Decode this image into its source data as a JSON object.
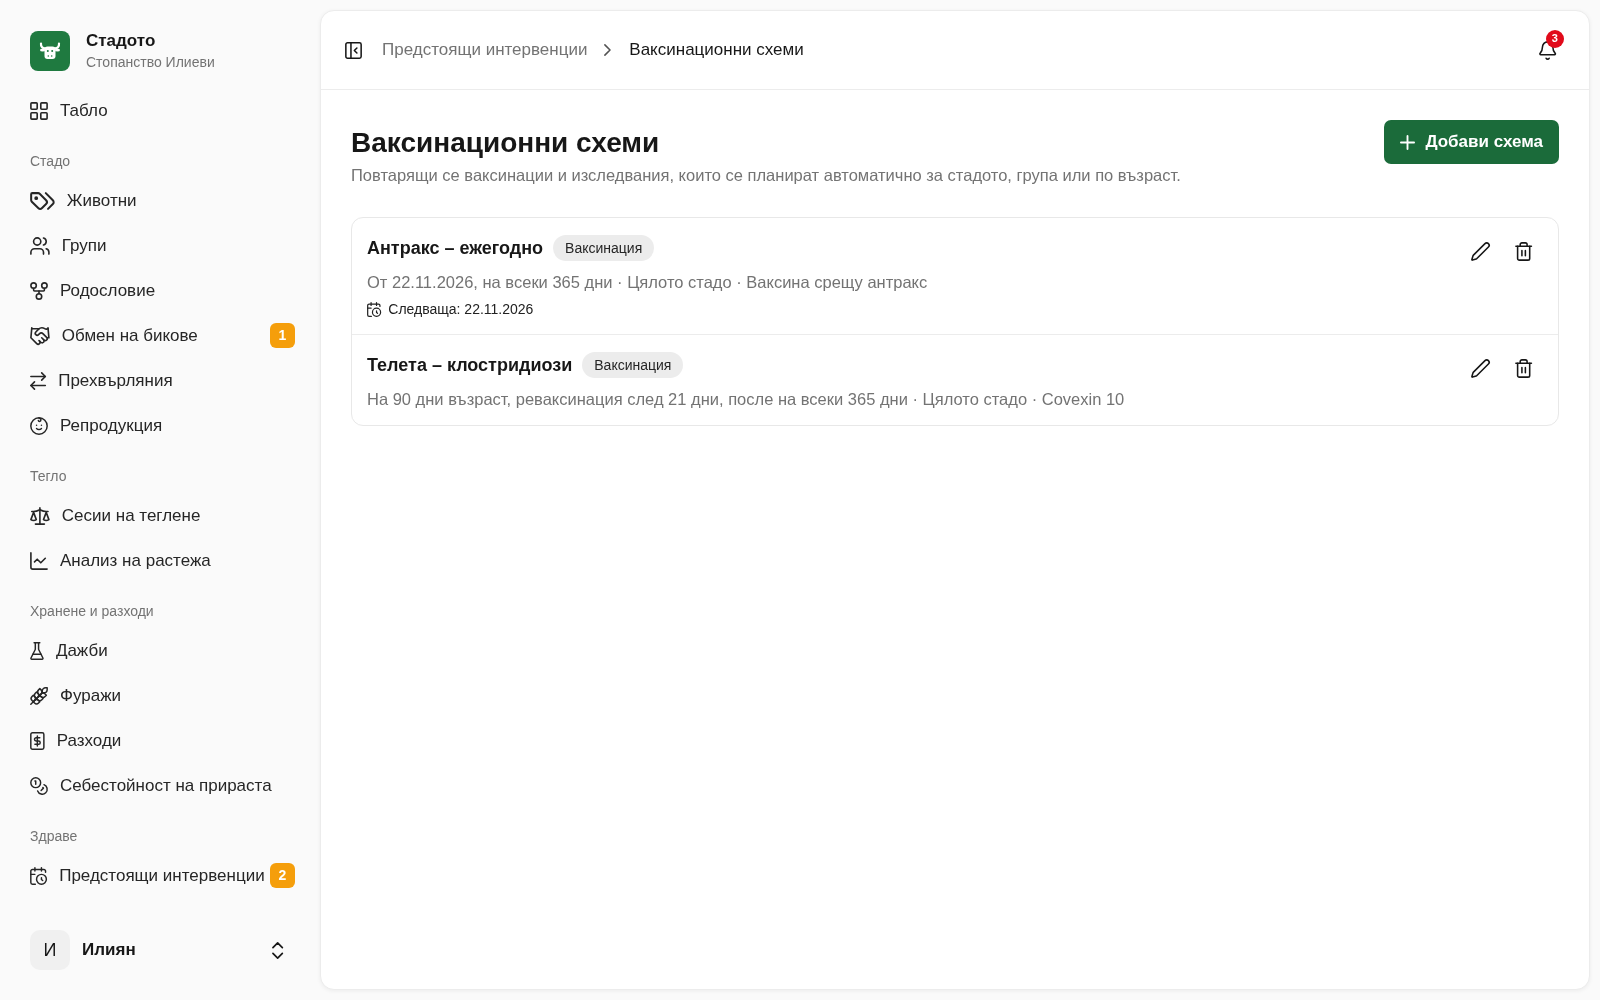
{
  "sidebar": {
    "brand": {
      "title": "Стадото",
      "subtitle": "Стопанство Илиеви"
    },
    "sections": [
      {
        "items": [
          {
            "label": "Табло",
            "selected": false
          }
        ]
      },
      {
        "heading": "Стадо",
        "items": [
          {
            "label": "Животни",
            "selected": false
          },
          {
            "label": "Групи",
            "selected": false
          },
          {
            "label": "Родословие",
            "selected": false
          },
          {
            "label": "Обмен на бикове",
            "selected": false,
            "badge": "1"
          },
          {
            "label": "Прехвърляния",
            "selected": false
          },
          {
            "label": "Репродукция",
            "selected": false
          }
        ]
      },
      {
        "heading": "Тегло",
        "items": [
          {
            "label": "Сесии на теглене",
            "selected": false
          },
          {
            "label": "Анализ на растежа",
            "selected": false
          }
        ]
      },
      {
        "heading": "Хранене и разходи",
        "items": [
          {
            "label": "Дажби",
            "selected": false
          },
          {
            "label": "Фуражи",
            "selected": false
          },
          {
            "label": "Разходи",
            "selected": false
          },
          {
            "label": "Себестойност на прираста",
            "selected": false
          }
        ]
      },
      {
        "heading": "Здраве",
        "items": [
          {
            "label": "Предстоящи интервенции",
            "selected": false,
            "badge": "2"
          }
        ]
      }
    ],
    "user": {
      "initial": "И",
      "name": "Илиян"
    }
  },
  "header": {
    "breadcrumb": [
      {
        "label": "Предстоящи интервенции",
        "current": false
      },
      {
        "label": "Ваксинационни схеми",
        "current": true
      }
    ],
    "notifications": {
      "count": "3"
    }
  },
  "page": {
    "title": "Ваксинационни схеми",
    "subtitle": "Повтарящи се ваксинации и изследвания, които се планират автоматично за стадото, група или по възраст.",
    "add_button": "Добави схема"
  },
  "schemes": [
    {
      "name": "Антракс – ежегодно",
      "tag": "Ваксинация",
      "details": "От 22.11.2026, на всеки 365 дни · Цялото стадо · Ваксина срещу антракс",
      "next": "Следваща: 22.11.2026"
    },
    {
      "name": "Телета – клостридиози",
      "tag": "Ваксинация",
      "details": "На 90 дни възраст, реваксинация след 21 дни, после на всеки 365 дни · Цялото стадо · Covexin 10"
    }
  ]
}
